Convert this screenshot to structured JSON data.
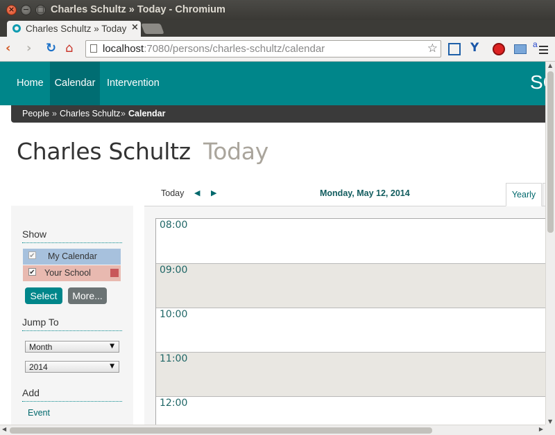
{
  "window": {
    "title": "Charles Schultz » Today - Chromium",
    "close_glyph": "×",
    "min_glyph": "−",
    "max_glyph": "□"
  },
  "tab": {
    "title": "Charles Schultz » Today",
    "close_glyph": "×"
  },
  "toolbar": {
    "url_host": "localhost",
    "url_path": ":7080/persons/charles-schultz/calendar",
    "back_glyph": "‹",
    "forward_glyph": "›",
    "reload_glyph": "↻",
    "home_glyph": "⌂",
    "star_glyph": "☆",
    "ext_v_glyph": "Y",
    "ext_a_glyph": "a"
  },
  "nav": {
    "items": [
      "Home",
      "Calendar",
      "Intervention"
    ],
    "active": "Calendar",
    "brand": "SC",
    "active_color": "#006d72",
    "bar_color": "#00868a"
  },
  "breadcrumb": {
    "items": [
      "People",
      "Charles Schultz",
      "Calendar"
    ],
    "separator": "»"
  },
  "page": {
    "title": "Charles Schultz",
    "subtitle": "Today"
  },
  "sidebar": {
    "show_heading": "Show",
    "calendars": [
      {
        "label": "My Calendar",
        "checked": true,
        "color": "#a7c1dd"
      },
      {
        "label": "Your School",
        "checked": true,
        "color": "#c8575a"
      }
    ],
    "check_glyph": "✔",
    "select_button": "Select",
    "more_button": "More...",
    "jump_heading": "Jump To",
    "jump_period": "Month",
    "jump_year": "2014",
    "dropdown_glyph": "▼",
    "add_heading": "Add",
    "add_event": "Event"
  },
  "calendar": {
    "today_label": "Today",
    "prev_glyph": "◀",
    "next_glyph": "▶",
    "date": "Monday, May 12, 2014",
    "view_tab": "Yearly",
    "hours": [
      "08:00",
      "09:00",
      "10:00",
      "11:00",
      "12:00"
    ]
  },
  "scroll": {
    "up": "▲",
    "down": "▼",
    "left": "◀",
    "right": "▶"
  }
}
